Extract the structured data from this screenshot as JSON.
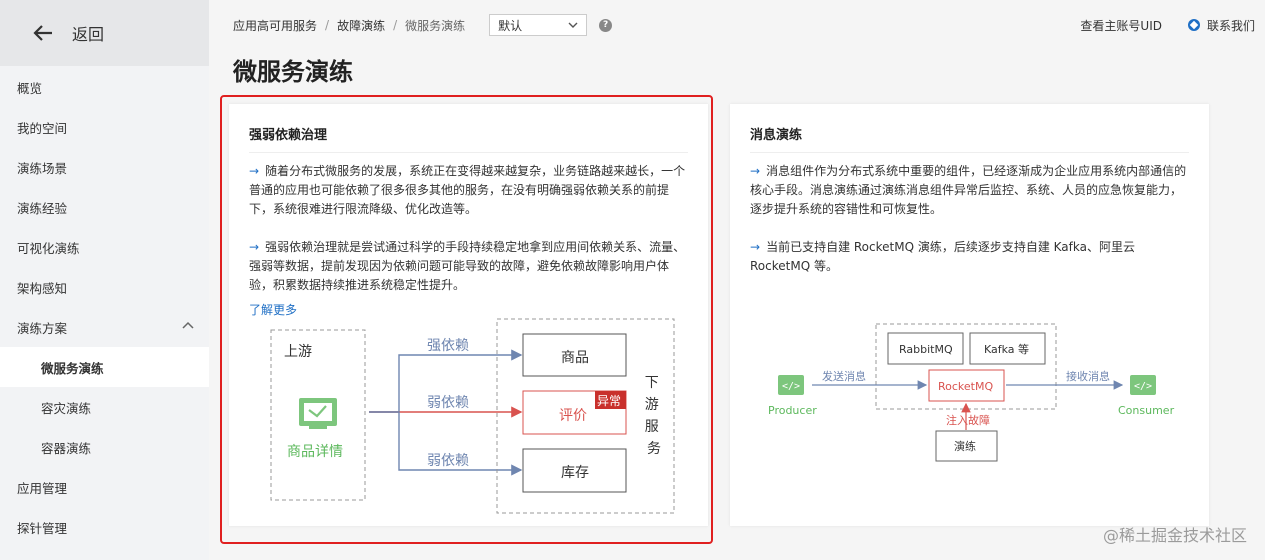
{
  "sidebar": {
    "back_label": "返回",
    "items": [
      {
        "label": "概览"
      },
      {
        "label": "我的空间"
      },
      {
        "label": "演练场景"
      },
      {
        "label": "演练经验"
      },
      {
        "label": "可视化演练"
      },
      {
        "label": "架构感知"
      },
      {
        "label": "演练方案"
      },
      {
        "label": "微服务演练"
      },
      {
        "label": "容灾演练"
      },
      {
        "label": "容器演练"
      },
      {
        "label": "应用管理"
      },
      {
        "label": "探针管理"
      }
    ]
  },
  "header": {
    "breadcrumbs": [
      "应用高可用服务",
      "故障演练",
      "微服务演练"
    ],
    "separator": "/",
    "select_value": "默认",
    "help_glyph": "?",
    "uid_link": "查看主账号UID",
    "contact_link": "联系我们"
  },
  "page_title": "微服务演练",
  "card1": {
    "title": "强弱依赖治理",
    "para1": "随着分布式微服务的发展，系统正在变得越来越复杂，业务链路越来越长，一个普通的应用也可能依赖了很多很多其他的服务，在没有明确强弱依赖关系的前提下，系统很难进行限流降级、优化改造等。",
    "para2": "强弱依赖治理就是尝试通过科学的手段持续稳定地拿到应用间依赖关系、流量、强弱等数据，提前发现因为依赖问题可能导致的故障，避免依赖故障影响用户体验，积累数据持续推进系统稳定性提升。",
    "more": "了解更多",
    "diagram": {
      "upstream": "上游",
      "app": "商品详情",
      "strong": "强依赖",
      "weak1": "弱依赖",
      "weak2": "弱依赖",
      "svc1": "商品",
      "svc2": "评价",
      "svc3": "库存",
      "abnormal": "异常",
      "downstream": "下游服务"
    }
  },
  "card2": {
    "title": "消息演练",
    "para1": "消息组件作为分布式系统中重要的组件，已经逐渐成为企业应用系统内部通信的核心手段。消息演练通过演练消息组件异常后监控、系统、人员的应急恢复能力，逐步提升系统的容错性和可恢复性。",
    "para2": "当前已支持自建 RocketMQ 演练，后续逐步支持自建 Kafka、阿里云 RocketMQ 等。",
    "diagram": {
      "rabbit": "RabbitMQ",
      "kafka": "Kafka 等",
      "rocket": "RocketMQ",
      "send": "发送消息",
      "recv": "接收消息",
      "producer": "Producer",
      "consumer": "Consumer",
      "inject": "注入故障",
      "drill": "演练"
    }
  },
  "watermark": "@稀土掘金技术社区",
  "colors": {
    "accent": "#1f6fc5",
    "green": "#5cb85c",
    "red": "#e02020",
    "diagram_blue": "#6f86b0"
  }
}
